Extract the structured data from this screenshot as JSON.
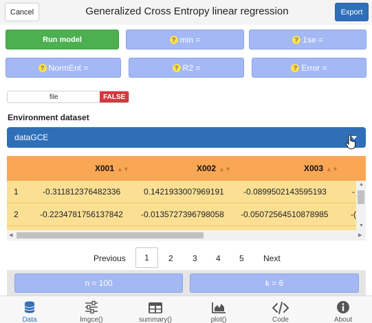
{
  "header": {
    "cancel_label": "Cancel",
    "title": "Generalized Cross Entropy linear regression",
    "export_label": "Export"
  },
  "buttons": {
    "run_model": "Run model",
    "min": "min =",
    "one_se": "1se =",
    "norment": "NormEnt =",
    "r2": "R2 =",
    "error": "Error ="
  },
  "help_glyph": "?",
  "toggle": {
    "label": "file",
    "value": "FALSE"
  },
  "dataset": {
    "label": "Environment dataset",
    "selected": "dataGCE"
  },
  "table": {
    "columns": [
      "X001",
      "X002",
      "X003"
    ],
    "rows": [
      {
        "index": "1",
        "cells": [
          "-0.311812376482336",
          "0.1421933007969191",
          "-0.0899502143595193",
          "-"
        ]
      },
      {
        "index": "2",
        "cells": [
          "-0.2234781756137842",
          "-0.0135727396798058",
          "-0.05072564510878985",
          "-("
        ]
      }
    ]
  },
  "pagination": {
    "previous": "Previous",
    "pages": [
      "1",
      "2",
      "3",
      "4",
      "5"
    ],
    "active_page": "1",
    "next": "Next"
  },
  "stats": {
    "n": "n = 100",
    "k": "k = 6"
  },
  "nav": [
    {
      "label": "Data",
      "icon": "database-icon",
      "active": true
    },
    {
      "label": "lmgce()",
      "icon": "sliders-icon",
      "active": false
    },
    {
      "label": "summary()",
      "icon": "table-icon",
      "active": false
    },
    {
      "label": "plot()",
      "icon": "area-chart-icon",
      "active": false
    },
    {
      "label": "Code",
      "icon": "code-icon",
      "active": false
    },
    {
      "label": "About",
      "icon": "info-icon",
      "active": false
    }
  ],
  "colors": {
    "primary_blue": "#2f6fb8",
    "pill_blue": "#a3b8f5",
    "run_green": "#4caf50",
    "table_header": "#f9a655",
    "table_row": "#fbe094",
    "false_red": "#d9363e"
  }
}
